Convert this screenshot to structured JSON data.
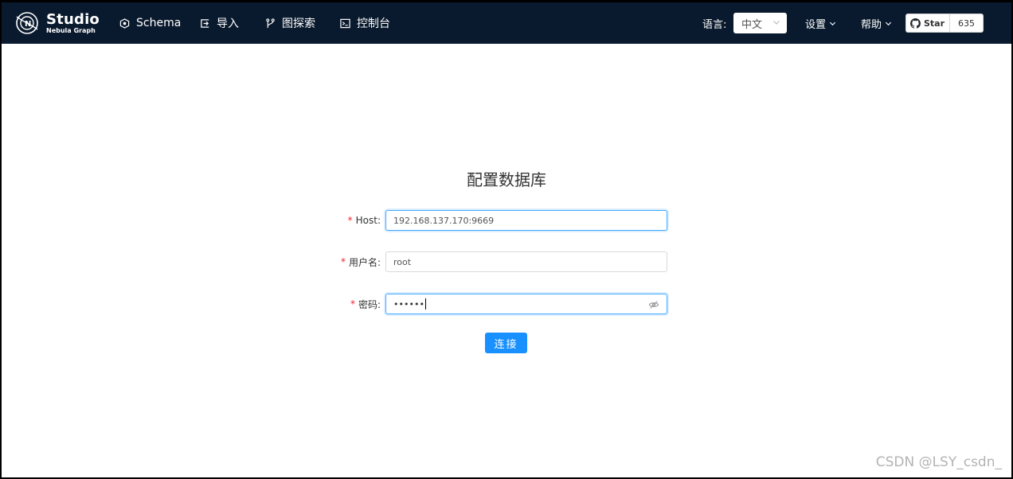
{
  "app": {
    "logo_title": "Studio",
    "logo_subtitle": "Nebula Graph"
  },
  "nav": {
    "items": [
      {
        "label": "Schema",
        "icon": "hexagon-icon"
      },
      {
        "label": "导入",
        "icon": "import-icon"
      },
      {
        "label": "图探索",
        "icon": "branch-icon"
      },
      {
        "label": "控制台",
        "icon": "terminal-icon"
      }
    ],
    "language_label": "语言:",
    "language_value": "中文",
    "settings_label": "设置",
    "help_label": "帮助",
    "github_star_label": "Star",
    "github_star_count": "635"
  },
  "form": {
    "title": "配置数据库",
    "host_label": "Host:",
    "host_value": "192.168.137.170:9669",
    "username_label": "用户名:",
    "username_value": "root",
    "password_label": "密码:",
    "password_mask": "••••••",
    "connect_label": "连接"
  },
  "watermark": "CSDN @LSY_csdn_",
  "colors": {
    "nav_bg": "#0a1a2e",
    "primary": "#1890ff",
    "required": "#f5222d"
  }
}
